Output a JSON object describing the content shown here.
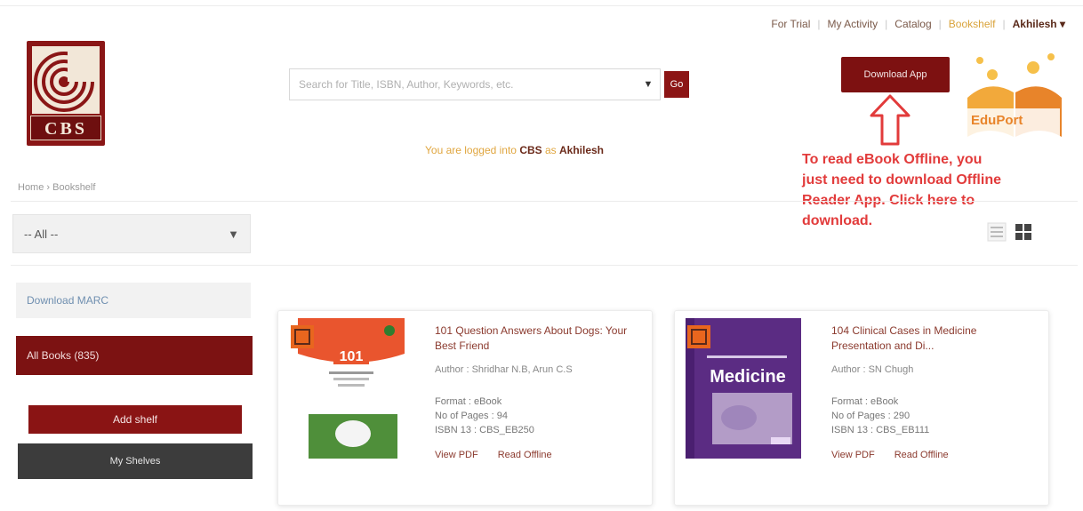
{
  "nav": {
    "items": [
      "For Trial",
      "My Activity",
      "Catalog",
      "Bookshelf"
    ],
    "user": "Akhilesh ▾"
  },
  "logo": {
    "text": "CBS"
  },
  "search": {
    "placeholder": "Search for Title, ISBN, Author, Keywords, etc.",
    "go_label": "Go"
  },
  "download_app": {
    "label": "Download App"
  },
  "eduport": {
    "brand": "EduPort"
  },
  "logged_in": {
    "prefix": "You are logged into ",
    "site": "CBS",
    "middle": " as ",
    "user": "Akhilesh"
  },
  "annotation": "To read eBook Offline, you just need to download Offline Reader App. Click here to download.",
  "breadcrumb": "Home › Bookshelf",
  "filter": {
    "selected": "-- All --"
  },
  "sidebar": {
    "download_marc": "Download MARC",
    "all_books": "All Books (835)",
    "add_shelf": "Add shelf",
    "my_shelves": "My Shelves"
  },
  "books": [
    {
      "title": "101 Question Answers About Dogs: Your Best Friend",
      "author": "Author : Shridhar N.B, Arun C.S",
      "format": "Format : eBook",
      "pages": "No of Pages : 94",
      "isbn": "ISBN 13 : CBS_EB250",
      "view_pdf": "View PDF",
      "read_offline": "Read Offline",
      "cover_label": "101",
      "colors": {
        "cover_top": "#e9552e",
        "cover_bg": "#ffffff",
        "cover_img": "#4f8f3a"
      }
    },
    {
      "title": "104 Clinical Cases in Medicine Presentation and Di...",
      "author": "Author : SN Chugh",
      "format": "Format : eBook",
      "pages": "No of Pages : 290",
      "isbn": "ISBN 13 : CBS_EB111",
      "view_pdf": "View PDF",
      "read_offline": "Read Offline",
      "cover_label": "Medicine",
      "colors": {
        "cover_top": "#5b2c83",
        "cover_bg": "#4a1f70",
        "cover_img": "#c9b9d8"
      }
    }
  ],
  "colors": {
    "brand": "#7d1111",
    "accent_gold": "#d9a33b",
    "annotation": "#e23b3b",
    "dark_button": "#3c3c3c"
  }
}
